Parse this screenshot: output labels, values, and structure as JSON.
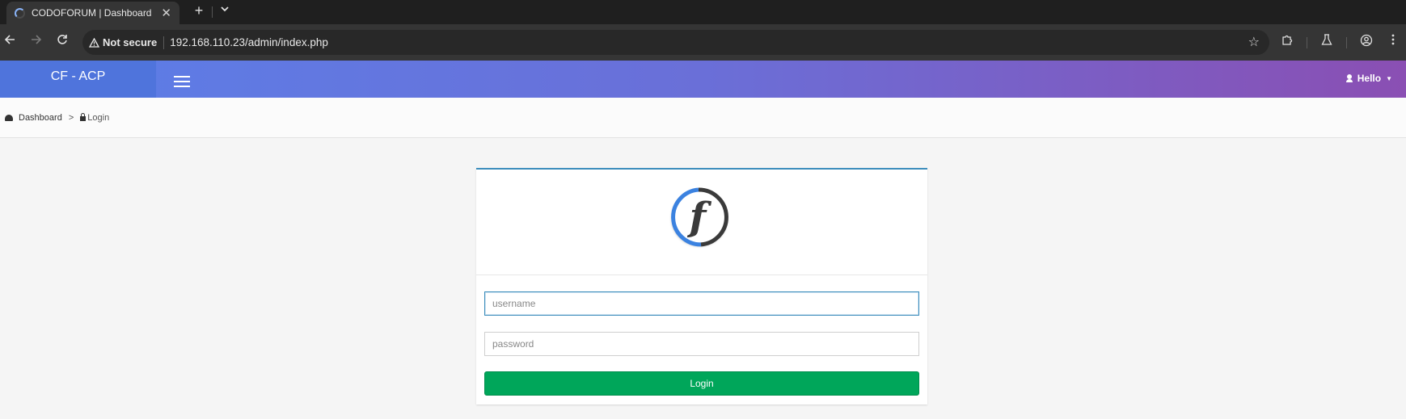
{
  "browser": {
    "tab_title": "CODOFORUM | Dashboard",
    "tab_close": "✕",
    "new_tab": "+",
    "tab_menu": "⌄",
    "security_label": "Not secure",
    "url": "192.168.110.23/admin/index.php"
  },
  "header": {
    "brand": "CF - ACP",
    "user_label": "Hello"
  },
  "breadcrumb": {
    "items": [
      "Dashboard",
      "Login"
    ],
    "separator": ">"
  },
  "login": {
    "username_placeholder": "username",
    "password_placeholder": "password",
    "username_value": "",
    "password_value": "",
    "submit_label": "Login"
  },
  "colors": {
    "header_start": "#5b7fe8",
    "header_end": "#8a4fb3",
    "login_button": "#00a65a",
    "panel_accent": "#3c8dbc"
  }
}
